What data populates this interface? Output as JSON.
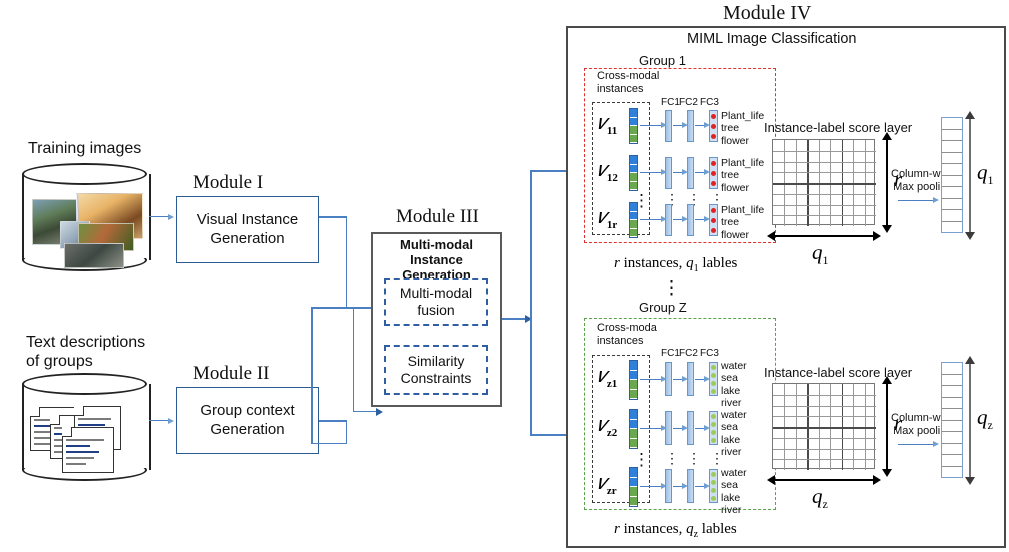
{
  "diagram": {
    "modules": {
      "m1_title": "Module I",
      "m1_body": "Visual Instance\nGeneration",
      "m2_title": "Module II",
      "m2_body": "Group context\nGeneration",
      "m3_title": "Module III",
      "m3_body": "Multi-modal Instance\nGeneration",
      "m3_sub1": "Multi-modal\nfusion",
      "m3_sub2": "Similarity\nConstraints",
      "m4_title": "Module IV",
      "m4_heading": "MIML Image  Classification"
    },
    "sources": {
      "images_label": "Training images",
      "text_label": "Text descriptions\nof groups"
    },
    "groups": [
      {
        "name": "Group 1",
        "cross_modal_label": "Cross-modal\ninstances",
        "fc_labels": [
          "FC1",
          "FC2",
          "FC3"
        ],
        "instances": [
          "v11",
          "v12",
          "v1r"
        ],
        "instance_subs": [
          "11",
          "12",
          "1r"
        ],
        "tags": [
          "Plant_life",
          "tree",
          "flower"
        ],
        "caption": "r instances, q1 lables",
        "score_layer_label": "Instance-label score layer",
        "pooling_label": "Column-wise\nMax pooling",
        "row_dim": "r",
        "col_dim": "q1",
        "out_dim": "q1",
        "border_color": "#e03131"
      },
      {
        "name": "Group Z",
        "cross_modal_label": "Cross-moda\ninstances",
        "fc_labels": [
          "FC1",
          "FC2",
          "FC3"
        ],
        "instances": [
          "vz1",
          "vz2",
          "vzr"
        ],
        "instance_subs": [
          "z1",
          "z2",
          "zr"
        ],
        "tags": [
          "water",
          "sea",
          "lake",
          "river"
        ],
        "caption": "r instances, qz lables",
        "score_layer_label": "Instance-label score layer",
        "pooling_label": "Column-wise\nMax pooling",
        "row_dim": "r",
        "col_dim": "qz",
        "out_dim": "qz",
        "border_color": "#5aa24a"
      }
    ],
    "colors": {
      "module_border_blue": "#2b5b94",
      "module_border_gray": "#5a5a5a",
      "arrow_blue": "#4a7fc1",
      "group1_dash": "#e03131",
      "groupz_dash": "#5aa24a",
      "vector_blue": "#2f80d8",
      "vector_green": "#6aa84f",
      "fc_layer": "#9fc0e8",
      "node_red": "#e02424",
      "node_green": "#9ccb5a"
    },
    "ellipsis": "⋮"
  }
}
